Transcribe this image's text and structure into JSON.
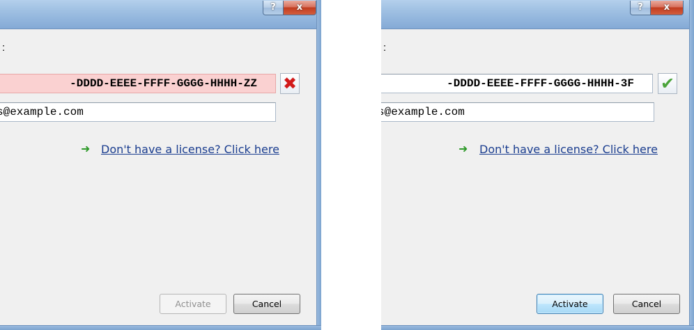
{
  "dialogs": [
    {
      "title_buttons": {
        "help": "?",
        "close": "x"
      },
      "label_fragment": ":",
      "license_key": {
        "value": "-DDDD-EEEE-FFFF-GGGG-HHHH-ZZ",
        "status": "invalid",
        "status_icon": "red-x-icon"
      },
      "email": {
        "value": "s@example.com"
      },
      "license_link": {
        "icon": "green-arrow-icon",
        "text": "Don't have a license? Click here"
      },
      "buttons": {
        "activate": "Activate",
        "activate_enabled": false,
        "cancel": "Cancel"
      }
    },
    {
      "title_buttons": {
        "help": "?",
        "close": "x"
      },
      "label_fragment": ":",
      "license_key": {
        "value": "-DDDD-EEEE-FFFF-GGGG-HHHH-3F",
        "status": "valid",
        "status_icon": "green-check-icon"
      },
      "email": {
        "value": "s@example.com"
      },
      "license_link": {
        "icon": "green-arrow-icon",
        "text": "Don't have a license? Click here"
      },
      "buttons": {
        "activate": "Activate",
        "activate_enabled": true,
        "cancel": "Cancel"
      }
    }
  ],
  "colors": {
    "invalid_field_bg": "#fad1d1",
    "error_icon": "#d21a1a",
    "valid_icon": "#4aa33a",
    "link": "#1a3d8f",
    "arrow": "#2f9a2a",
    "title_bar": "#9ebfe2"
  }
}
